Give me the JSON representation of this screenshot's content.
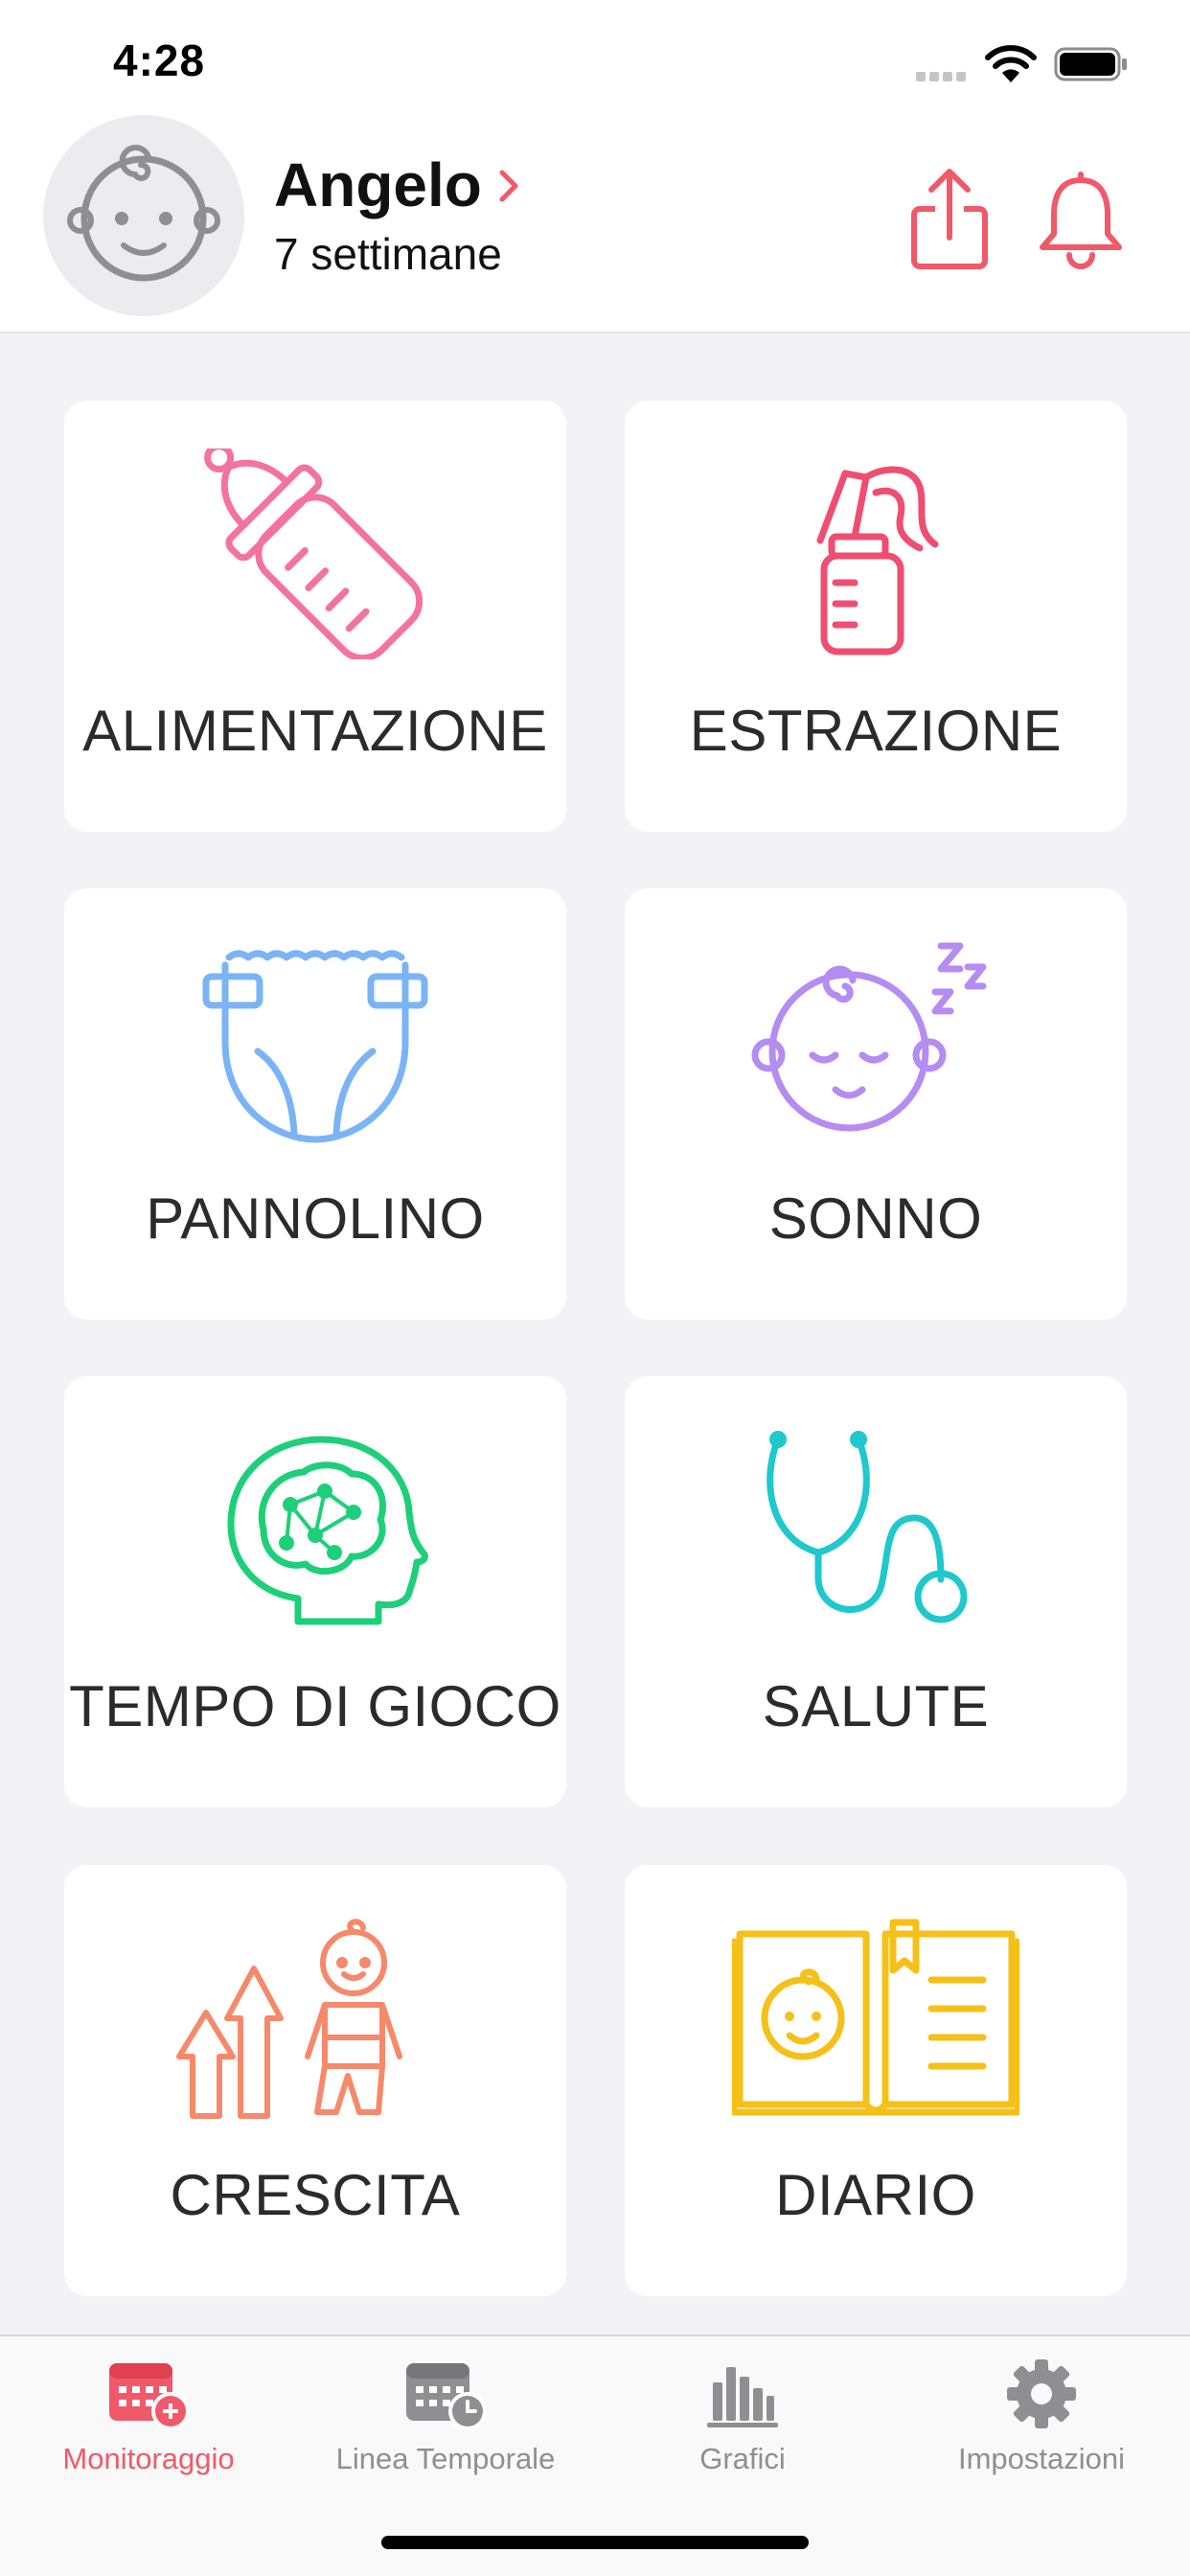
{
  "status_bar": {
    "time": "4:28"
  },
  "header": {
    "baby_name": "Angelo",
    "baby_age": "7 settimane",
    "icons": {
      "share": "share-icon",
      "notifications": "bell-icon",
      "avatar": "baby-face-icon"
    }
  },
  "tiles": [
    {
      "label": "ALIMENTAZIONE",
      "icon": "baby-bottle-icon",
      "color": "#f472a0"
    },
    {
      "label": "ESTRAZIONE",
      "icon": "breast-pump-icon",
      "color": "#ef4d72"
    },
    {
      "label": "PANNOLINO",
      "icon": "diaper-icon",
      "color": "#7ab4f5"
    },
    {
      "label": "SONNO",
      "icon": "sleeping-baby-icon",
      "color": "#b48cf2"
    },
    {
      "label": "TEMPO DI GIOCO",
      "icon": "brain-head-icon",
      "color": "#1ecf79"
    },
    {
      "label": "SALUTE",
      "icon": "stethoscope-icon",
      "color": "#1ec8cc"
    },
    {
      "label": "CRESCITA",
      "icon": "growth-icon",
      "color": "#f5896a"
    },
    {
      "label": "DIARIO",
      "icon": "baby-journal-icon",
      "color": "#f5c018"
    }
  ],
  "tab_bar": {
    "tabs": [
      {
        "label": "Monitoraggio",
        "icon": "calendar-add-icon",
        "active": true
      },
      {
        "label": "Linea Temporale",
        "icon": "calendar-clock-icon",
        "active": false
      },
      {
        "label": "Grafici",
        "icon": "bar-chart-icon",
        "active": false
      },
      {
        "label": "Impostazioni",
        "icon": "gear-icon",
        "active": false
      }
    ]
  },
  "colors": {
    "accent": "#f0596a",
    "background": "#f2f2f7",
    "inactive": "#8e8e93"
  }
}
